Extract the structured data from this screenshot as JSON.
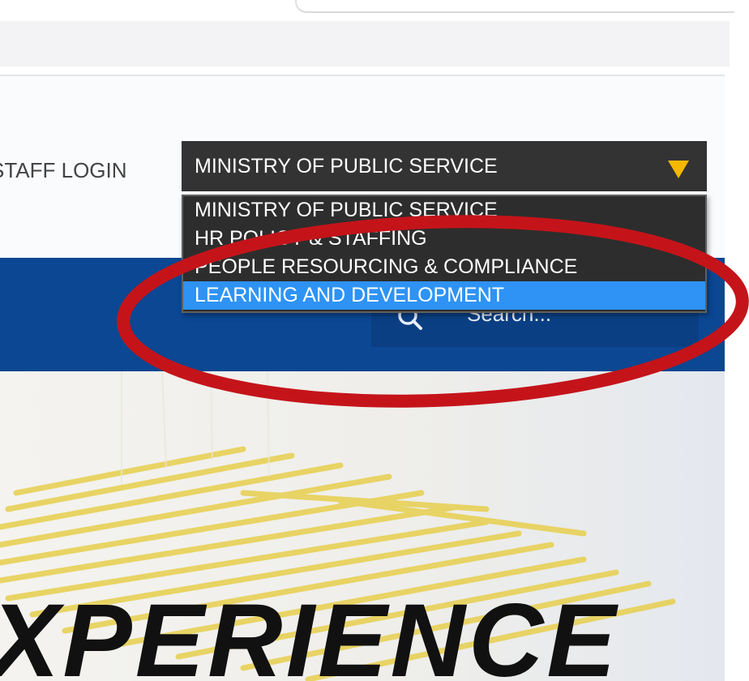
{
  "header": {
    "staff_login_label": "STAFF LOGIN"
  },
  "ministry_select": {
    "selected_value": "MINISTRY OF PUBLIC SERVICE",
    "arrow_color": "#f5b800",
    "options": [
      {
        "label": "MINISTRY OF PUBLIC SERVICE",
        "highlighted": false
      },
      {
        "label": "HR POLICY & STAFFING",
        "highlighted": false
      },
      {
        "label": "PEOPLE RESOURCING & COMPLIANCE",
        "highlighted": false
      },
      {
        "label": "LEARNING AND DEVELOPMENT",
        "highlighted": true
      }
    ],
    "highlight_color": "#2e93f5"
  },
  "nav": {
    "background_color": "#0b4792",
    "search_placeholder": "Search...",
    "search_icon": "search-icon"
  },
  "hero": {
    "headline": "XPERIENCE"
  },
  "annotation": {
    "shape": "ellipse",
    "color": "#c4141a"
  }
}
